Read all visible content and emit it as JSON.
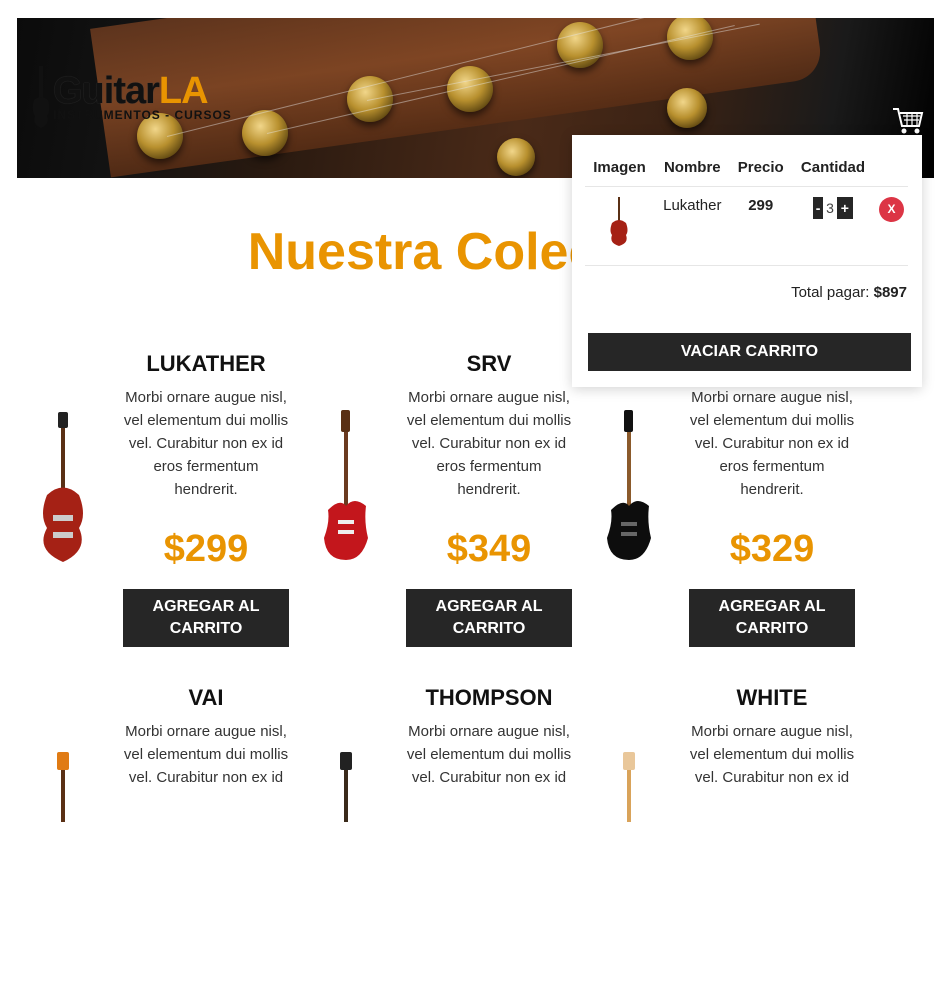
{
  "header": {
    "logo_main": "Guitar",
    "logo_accent": "LA",
    "logo_sub": "INSTRUMENTOS - CURSOS",
    "cart_icon": "cart-icon"
  },
  "title": "Nuestra Colección",
  "products": [
    {
      "name": "Lukather",
      "desc": "Morbi ornare augue nisl, vel elementum dui mollis vel. Curabitur non ex id eros fermentum hendrerit.",
      "price": "$299",
      "button": "Agregar al Carrito"
    },
    {
      "name": "SRV",
      "desc": "Morbi ornare augue nisl, vel elementum dui mollis vel. Curabitur non ex id eros fermentum hendrerit.",
      "price": "$349",
      "button": "Agregar al Carrito"
    },
    {
      "name": "",
      "desc": "Morbi ornare augue nisl, vel elementum dui mollis vel. Curabitur non ex id eros fermentum hendrerit.",
      "price": "$329",
      "button": "Agregar al Carrito"
    },
    {
      "name": "Vai",
      "desc": "Morbi ornare augue nisl, vel elementum dui mollis vel. Curabitur non ex id",
      "price": "",
      "button": ""
    },
    {
      "name": "Thompson",
      "desc": "Morbi ornare augue nisl, vel elementum dui mollis vel. Curabitur non ex id",
      "price": "",
      "button": ""
    },
    {
      "name": "White",
      "desc": "Morbi ornare augue nisl, vel elementum dui mollis vel. Curabitur non ex id",
      "price": "",
      "button": ""
    }
  ],
  "cart": {
    "headers": [
      "Imagen",
      "Nombre",
      "Precio",
      "Cantidad"
    ],
    "items": [
      {
        "name": "Lukather",
        "price": "299",
        "qty": "3",
        "minus": "-",
        "plus": "+",
        "remove": "X"
      }
    ],
    "total_label": "Total pagar:",
    "total_value": "$897",
    "empty_button": "Vaciar Carrito"
  },
  "colors": {
    "accent": "#e99401",
    "dark": "#262626",
    "danger": "#dc3545"
  }
}
